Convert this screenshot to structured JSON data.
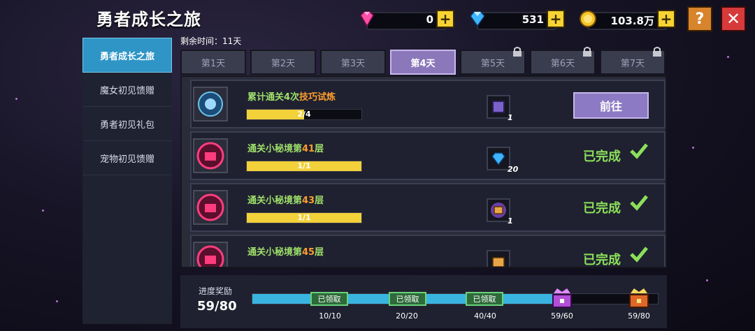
{
  "title": "勇者成长之旅",
  "resources": [
    {
      "name": "gem",
      "value": "0",
      "color": "#ff4fa8"
    },
    {
      "name": "diamond",
      "value": "531",
      "color": "#3fb4ff"
    },
    {
      "name": "gold",
      "value": "103.8万",
      "color": "#f7c62a"
    }
  ],
  "sidebar": {
    "items": [
      {
        "label": "勇者成长之旅",
        "active": true
      },
      {
        "label": "魔女初见馈赠",
        "active": false
      },
      {
        "label": "勇者初见礼包",
        "active": false
      },
      {
        "label": "宠物初见馈赠",
        "active": false
      }
    ]
  },
  "countdown": "剩余时间：11天",
  "tabs": [
    {
      "label": "第1天",
      "locked": false,
      "active": false
    },
    {
      "label": "第2天",
      "locked": false,
      "active": false
    },
    {
      "label": "第3天",
      "locked": false,
      "active": false
    },
    {
      "label": "第4天",
      "locked": false,
      "active": true
    },
    {
      "label": "第5天",
      "locked": true,
      "active": false
    },
    {
      "label": "第6天",
      "locked": true,
      "active": false
    },
    {
      "label": "第7天",
      "locked": true,
      "active": false
    }
  ],
  "tasks": [
    {
      "prefix": "累计通关4次",
      "highlight": "技巧试炼",
      "suffix": "",
      "progress_text": "2/4",
      "progress": 0.5,
      "reward_qty": "1",
      "status": "go",
      "button_label": "前往"
    },
    {
      "prefix": "通关小秘境第",
      "highlight": "41",
      "suffix": "层",
      "progress_text": "1/1",
      "progress": 1,
      "reward_qty": "20",
      "status": "done",
      "done_label": "已完成"
    },
    {
      "prefix": "通关小秘境第",
      "highlight": "43",
      "suffix": "层",
      "progress_text": "1/1",
      "progress": 1,
      "reward_qty": "1",
      "status": "done",
      "done_label": "已完成"
    },
    {
      "prefix": "通关小秘境第",
      "highlight": "45",
      "suffix": "层",
      "progress_text": "",
      "progress": 1,
      "reward_qty": "",
      "status": "done",
      "done_label": "已完成"
    }
  ],
  "progress_reward": {
    "label": "进度奖励",
    "value": "59/80",
    "fraction": 0.74,
    "milestones": [
      {
        "label": "10/10",
        "claimed_label": "已领取",
        "state": "claimed"
      },
      {
        "label": "20/20",
        "claimed_label": "已领取",
        "state": "claimed"
      },
      {
        "label": "40/40",
        "claimed_label": "已领取",
        "state": "claimed"
      },
      {
        "label": "59/60",
        "state": "chest-purple"
      },
      {
        "label": "59/80",
        "state": "chest-gold"
      }
    ]
  }
}
